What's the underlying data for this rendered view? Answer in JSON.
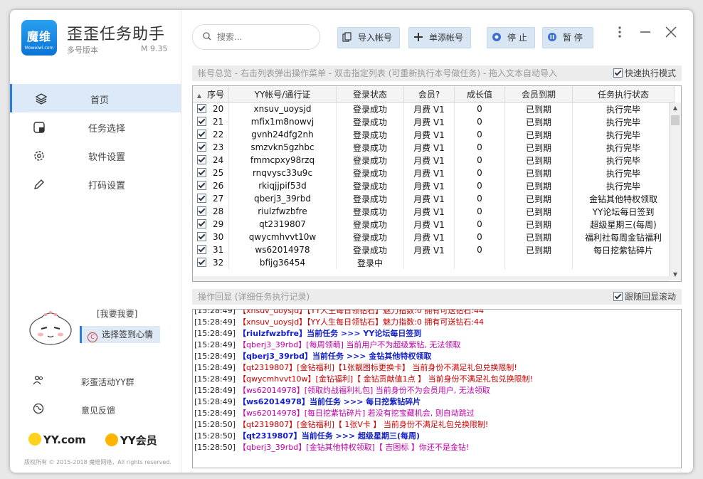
{
  "app": {
    "logo_line1": "魔维",
    "logo_line2": "Moweiwl.com",
    "title": "歪歪任务助手",
    "subtitle": "多号版本",
    "version": "M 9.35"
  },
  "nav": [
    {
      "label": "首页",
      "icon": "layers-icon",
      "active": true
    },
    {
      "label": "任务选择",
      "icon": "cube-icon",
      "active": false
    },
    {
      "label": "软件设置",
      "icon": "gear-icon",
      "active": false
    },
    {
      "label": "打码设置",
      "icon": "pencil-icon",
      "active": false
    }
  ],
  "mood": {
    "title": "[我要我要]",
    "button": "选择签到心情"
  },
  "bottom_links": [
    {
      "label": "彩蛋活动YY群",
      "icon": "people-icon"
    },
    {
      "label": "意见反馈",
      "icon": "globe-icon"
    }
  ],
  "brands": {
    "yy": "YY.com",
    "vip": "YY会员"
  },
  "copyright": "版权所有 © 2015-2018 魔维网络，All rights reserved.",
  "toolbar": {
    "search_placeholder": "搜索...",
    "import_label": "导入帐号",
    "add_label": "单添帐号",
    "stop_label": "停 止",
    "pause_label": "暂 停"
  },
  "accounts_panel": {
    "header": "帐号总览 - 右击列表弹出操作菜单 - 双击指定列表 (可重新执行本号做任务) - 拖入文本自动导入",
    "quick_mode_label": "快速执行模式",
    "columns": [
      "序号",
      "YY帐号/通行证",
      "登录状态",
      "会员?",
      "成长值",
      "会员到期",
      "任务执行状态"
    ],
    "rows": [
      {
        "no": "20",
        "account": "xnsuv_uoysjd",
        "login": "登录成功",
        "vip": "月费 V1",
        "growth": "0",
        "expire": "已到期",
        "task": "执行完毕"
      },
      {
        "no": "21",
        "account": "mfix1m8nowvj",
        "login": "登录成功",
        "vip": "月费 V1",
        "growth": "0",
        "expire": "已到期",
        "task": "执行完毕"
      },
      {
        "no": "22",
        "account": "gvnh24dfg2nh",
        "login": "登录成功",
        "vip": "月费 V1",
        "growth": "0",
        "expire": "已到期",
        "task": "执行完毕"
      },
      {
        "no": "23",
        "account": "smzvkn5gzhbc",
        "login": "登录成功",
        "vip": "月费 V1",
        "growth": "0",
        "expire": "已到期",
        "task": "执行完毕"
      },
      {
        "no": "24",
        "account": "fmmcpxy98rzq",
        "login": "登录成功",
        "vip": "月费 V1",
        "growth": "0",
        "expire": "已到期",
        "task": "执行完毕"
      },
      {
        "no": "25",
        "account": "rnqvysc33u9c",
        "login": "登录成功",
        "vip": "月费 V1",
        "growth": "0",
        "expire": "已到期",
        "task": "执行完毕"
      },
      {
        "no": "26",
        "account": "rkiqjjpif53d",
        "login": "登录成功",
        "vip": "月费 V1",
        "growth": "0",
        "expire": "已到期",
        "task": "执行完毕"
      },
      {
        "no": "27",
        "account": "qberj3_39rbd",
        "login": "登录成功",
        "vip": "月费 V1",
        "growth": "0",
        "expire": "已到期",
        "task": "金钻其他特权领取"
      },
      {
        "no": "28",
        "account": "riulzfwzbfre",
        "login": "登录成功",
        "vip": "月费 V1",
        "growth": "0",
        "expire": "已到期",
        "task": "YY论坛每日签到"
      },
      {
        "no": "29",
        "account": "qt2319807",
        "login": "登录成功",
        "vip": "月费 V1",
        "growth": "0",
        "expire": "已到期",
        "task": "超级星期三(每周)"
      },
      {
        "no": "30",
        "account": "qwycmhvvt10w",
        "login": "登录成功",
        "vip": "月费 V1",
        "growth": "0",
        "expire": "已到期",
        "task": "福利社每周金钻福利"
      },
      {
        "no": "31",
        "account": "ws62014978",
        "login": "登录成功",
        "vip": "月费 V1",
        "growth": "0",
        "expire": "已到期",
        "task": "每日挖紫钻碎片"
      },
      {
        "no": "32",
        "account": "bfijg36454",
        "login": "登录中",
        "vip": "",
        "growth": "",
        "expire": "",
        "task": ""
      }
    ]
  },
  "log_panel": {
    "header": "操作回显 (详细任务执行记录)",
    "follow_label": "跟随回显滚动",
    "lines": [
      {
        "time": "[15:28:49]",
        "text": "【xnsuv_uoysjd】【YY人生每日领钻石】魅力指数:0 拥有可送钻石:44",
        "style": "red"
      },
      {
        "time": "[15:28:49]",
        "text": "【xnsuv_uoysjd】【YY人生每日领钻石】魅力指数:0 拥有可送钻石:44",
        "style": "red"
      },
      {
        "time": "[15:28:49]",
        "text": "【riulzfwzbfre】当前任务 >>> YY论坛每日签到",
        "style": "blue"
      },
      {
        "time": "[15:28:49]",
        "text": "【qberj3_39rbd】[每周领萌] 当前用户不为超级紫钻, 无法领取",
        "style": "pink"
      },
      {
        "time": "[15:28:49]",
        "text": "【qberj3_39rbd】当前任务 >>> 金钻其他特权领取",
        "style": "blue"
      },
      {
        "time": "[15:28:49]",
        "text": "【qt2319807】[金钻福利]【1张靓图标更换卡】 当前身份不满足礼包兑换限制!",
        "style": "red"
      },
      {
        "time": "[15:28:49]",
        "text": "【qwycmhvvt10w】[金钻福利]【 金钻贡献值1点 】 当前身份不满足礼包兑换限制!",
        "style": "red"
      },
      {
        "time": "[15:28:49]",
        "text": "【ws62014978】[领取约战福利礼包] 当前身份不为会员用户, 无法领取",
        "style": "pink"
      },
      {
        "time": "[15:28:49]",
        "text": "【ws62014978】当前任务 >>> 每日挖紫钻碎片",
        "style": "blue"
      },
      {
        "time": "[15:28:49]",
        "text": "【ws62014978】[每日挖紫钻碎片] 若没有挖宝藏机会, 则自动跳过",
        "style": "pink"
      },
      {
        "time": "[15:28:50]",
        "text": "【qt2319807】[金钻福利]【 1张V卡 】 当前身份不满足礼包兑换限制!",
        "style": "red"
      },
      {
        "time": "[15:28:50]",
        "text": "【qt2319807】当前任务 >>> 超级星期三(每周)",
        "style": "blue"
      },
      {
        "time": "[15:28:50]",
        "text": "【qberj3_39rbd】[金钻其他特权领取]【 吉图标 】你还不是金钻!",
        "style": "pink"
      }
    ]
  },
  "colors": {
    "accent": "#2a7ad6",
    "log_blue": "#1420c8",
    "log_red": "#d00000",
    "log_pink": "#c000a8"
  }
}
